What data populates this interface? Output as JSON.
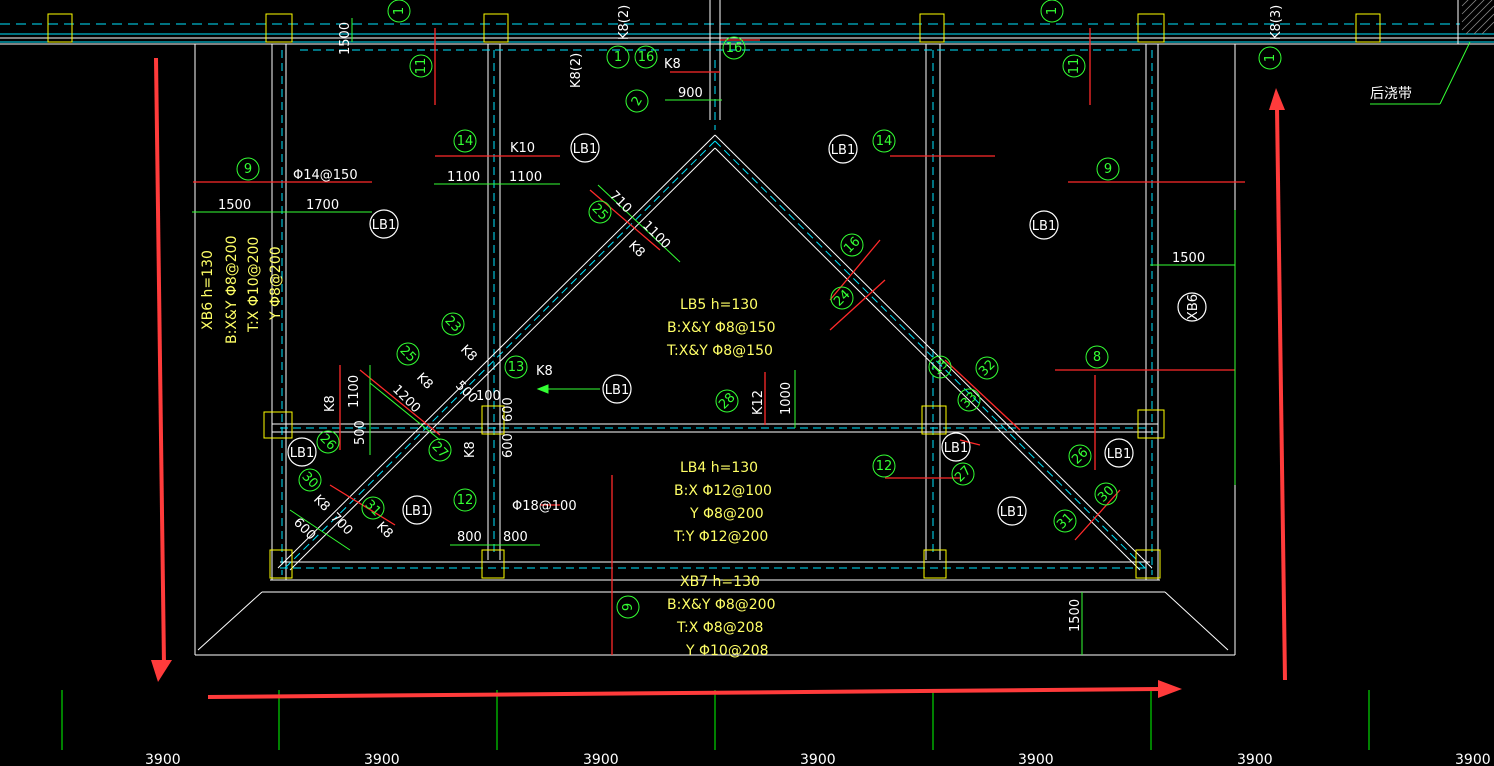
{
  "colors": {
    "background": "#000000",
    "frame": "#ffffff",
    "axis": "#00ff00",
    "dashed": "#00e5ff",
    "rebar": "#ff2a2a",
    "dim": "#33ff33",
    "column": "#ffff00",
    "note_text": "#ffff66",
    "arrow": "#ff3b3b",
    "grid_top": "#00e5ff"
  },
  "axis_dimensions": [
    "3900",
    "3900",
    "3900",
    "3900",
    "3900",
    "3900",
    "3900"
  ],
  "slab_labels": {
    "lb1": "LB1",
    "xb6": "XB6"
  },
  "lb5": {
    "title": "LB5  h=130",
    "bottom": "B:X&Y Φ8@150",
    "top": "T:X&Y Φ8@150"
  },
  "lb4": {
    "title": "LB4  h=130",
    "bottom_x": "B:X Φ12@100",
    "bottom_y": "Y Φ8@200",
    "top_y": "T:Y Φ12@200"
  },
  "xb7": {
    "title": "XB7  h=130",
    "bottom": "B:X&Y Φ8@200",
    "top_x": "T:X Φ8@208",
    "top_y": "Y Φ10@208"
  },
  "xb6": {
    "title": "XB6  h=130",
    "bottom": "B:X&Y Φ8@200",
    "top_x": "T:X Φ10@200",
    "top_y": "Y Φ8@200"
  },
  "bar_notes": {
    "phi14": "Φ14@150",
    "phi18": "Φ18@100",
    "k8": "K8",
    "k10": "K10",
    "k12": "K12",
    "k8_2": "K8(2)",
    "k8_3": "K8(3)"
  },
  "dims": {
    "d1500": "1500",
    "d1700": "1700",
    "d1100": "1100",
    "d900": "900",
    "d710": "710",
    "d1200": "1200",
    "d500": "500",
    "d600": "600",
    "d700": "700",
    "d800": "800",
    "d1000": "1000",
    "d100": "100"
  },
  "bar_numbers": {
    "n1": "1",
    "n2": "2",
    "n8": "8",
    "n9": "9",
    "n11": "11",
    "n12": "12",
    "n13": "13",
    "n14": "14",
    "n16": "16",
    "n23": "23",
    "n24": "24",
    "n25": "25",
    "n26": "26",
    "n27": "27",
    "n28": "28",
    "n30": "30",
    "n31": "31",
    "n32": "32",
    "n33": "33"
  },
  "post_pour_strip": "后浇带"
}
